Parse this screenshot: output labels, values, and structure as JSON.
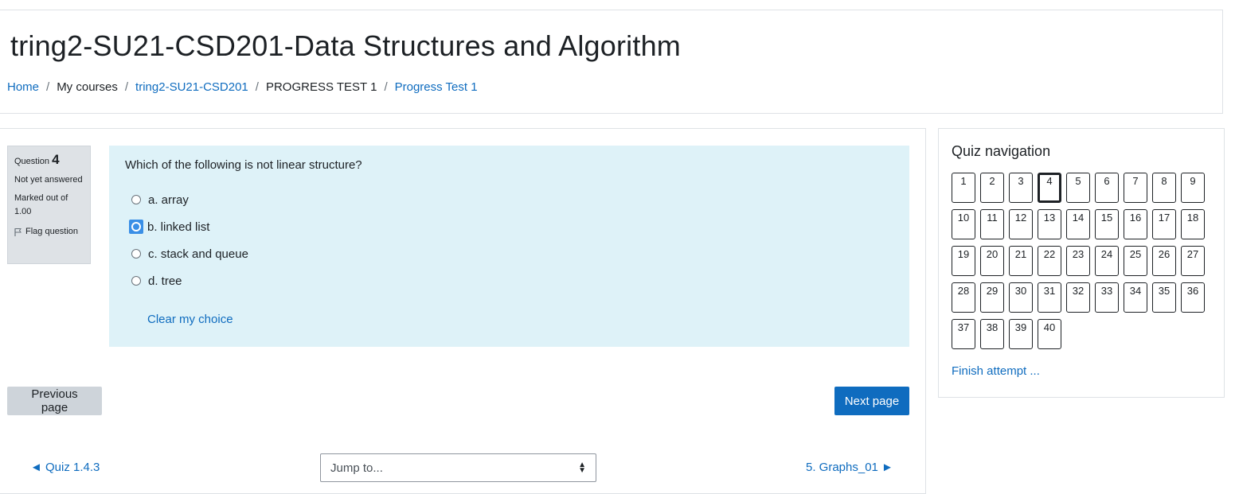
{
  "header": {
    "title": "tring2-SU21-CSD201-Data Structures and Algorithm",
    "breadcrumb": [
      "Home",
      "My courses",
      "tring2-SU21-CSD201",
      "PROGRESS TEST 1",
      "Progress Test 1"
    ]
  },
  "question": {
    "label": "Question",
    "number": "4",
    "state": "Not yet answered",
    "grade": "Marked out of 1.00",
    "flag_label": "Flag question",
    "text": "Which of the following is not linear structure?",
    "answers": [
      "a. array",
      "b. linked list",
      "c. stack and queue",
      "d. tree"
    ],
    "focused_answer_index": 1,
    "clear_choice": "Clear my choice"
  },
  "pagination": {
    "previous": "Previous page",
    "next": "Next page"
  },
  "activity_nav": {
    "prev_link": "◄ Quiz 1.4.3",
    "jump_placeholder": "Jump to...",
    "next_link": "5. Graphs_01 ►"
  },
  "quiz_navigation": {
    "title": "Quiz navigation",
    "current": "4",
    "questions": [
      "1",
      "2",
      "3",
      "4",
      "5",
      "6",
      "7",
      "8",
      "9",
      "10",
      "11",
      "12",
      "13",
      "14",
      "15",
      "16",
      "17",
      "18",
      "19",
      "20",
      "21",
      "22",
      "23",
      "24",
      "25",
      "26",
      "27",
      "28",
      "29",
      "30",
      "31",
      "32",
      "33",
      "34",
      "35",
      "36",
      "37",
      "38",
      "39",
      "40"
    ],
    "finish": "Finish attempt ..."
  },
  "colors": {
    "link": "#0f6cbf",
    "formulation_bg": "#def2f8",
    "info_bg": "#dee2e6",
    "primary_button": "#0f6cbf"
  }
}
